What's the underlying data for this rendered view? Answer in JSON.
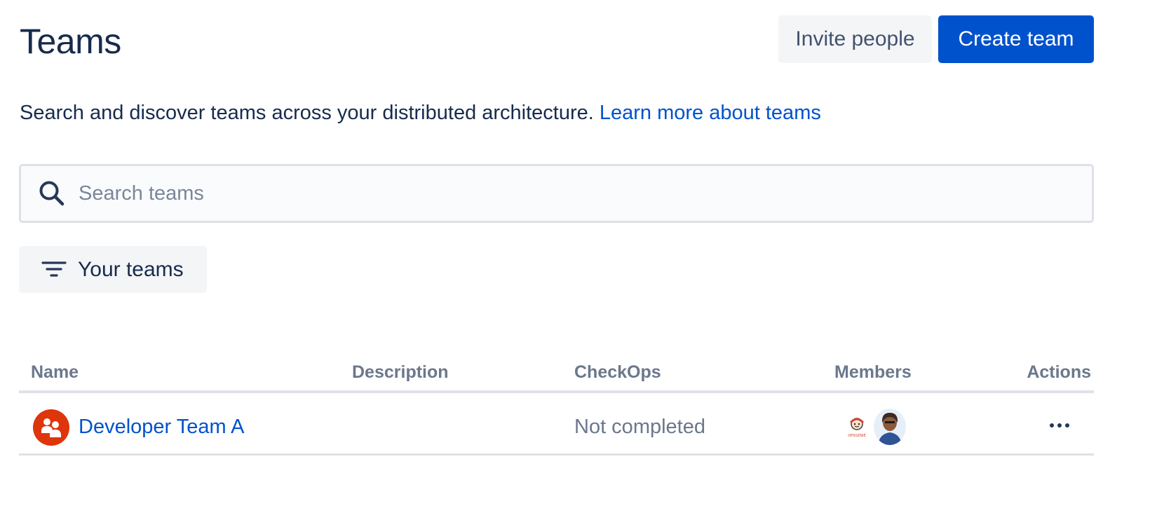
{
  "header": {
    "title": "Teams",
    "invite_label": "Invite people",
    "create_label": "Create team"
  },
  "intro": {
    "text": "Search and discover teams across your distributed architecture.",
    "link_text": "Learn more about teams"
  },
  "search": {
    "placeholder": "Search teams",
    "value": "",
    "icon": "search-icon"
  },
  "filter": {
    "label": "Your teams",
    "icon": "filter-icon"
  },
  "table": {
    "columns": [
      "Name",
      "Description",
      "CheckOps",
      "Members",
      "Actions"
    ],
    "rows": [
      {
        "name": "Developer Team A",
        "description": "",
        "checkops": "Not completed",
        "members": [
          "member-avatar-1",
          "member-avatar-2"
        ],
        "actions_icon": "more-icon"
      }
    ]
  },
  "colors": {
    "primary": "#0052cc",
    "text": "#172b4d",
    "subtle_text": "#6b778c",
    "team_avatar": "#de350b",
    "button_neutral": "#f4f5f7"
  }
}
